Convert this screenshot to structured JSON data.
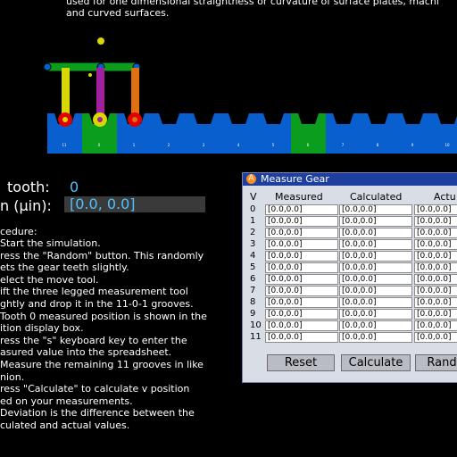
{
  "intro_lines": [
    "used for one dimensional straightness or curvature of surface plates, machi",
    "and curved surfaces."
  ],
  "gear": {
    "teeth": [
      {
        "label": "11",
        "color": "#0a5fcf"
      },
      {
        "label": "0",
        "color": "#0b9e1e"
      },
      {
        "label": "1",
        "color": "#0a5fcf"
      },
      {
        "label": "2",
        "color": "#0a5fcf"
      },
      {
        "label": "3",
        "color": "#0a5fcf"
      },
      {
        "label": "4",
        "color": "#0a5fcf"
      },
      {
        "label": "5",
        "color": "#0a5fcf"
      },
      {
        "label": "6",
        "color": "#0b9e1e"
      },
      {
        "label": "7",
        "color": "#0a5fcf"
      },
      {
        "label": "8",
        "color": "#0a5fcf"
      },
      {
        "label": "9",
        "color": "#0a5fcf"
      },
      {
        "label": "10",
        "color": "#0a5fcf"
      }
    ]
  },
  "tool": {
    "bar_color": "#0b9e1e",
    "leg_colors": [
      "#d8d800",
      "#a020a0",
      "#e07010"
    ],
    "foot_color": "#e00000"
  },
  "readout": {
    "tooth_label": "tooth:",
    "tooth_value": "0",
    "position_label": "n (μin):",
    "position_value": "[0.0, 0.0]"
  },
  "procedure": {
    "title": "cedure:",
    "lines": [
      "Start the simulation.",
      "ress the \"Random\" button. This randomly",
      "ets the gear teeth slightly.",
      "elect the move tool.",
      "ift the three legged measurement tool",
      "ghtly and drop it in the 11-0-1 grooves.",
      "Tooth 0 measured position is shown in the",
      "ition display box.",
      "ress the \"s\" keyboard key to enter the",
      "asured value into the spreadsheet.",
      "Measure the remaining 11 grooves in like",
      "nion.",
      "ress \"Calculate\" to calculate v position",
      "ed on your measurements.",
      "Deviation is the difference between the",
      "culated and actual values."
    ]
  },
  "dialog": {
    "title": "Measure Gear",
    "icon_letter": "A",
    "headers": {
      "v": "V",
      "measured": "Measured",
      "calculated": "Calculated",
      "actual": "Actu"
    },
    "rows": [
      {
        "v": "0",
        "measured": "[0.0,0.0]",
        "calculated": "[0.0,0.0]",
        "actual": "[0.0,0.0]"
      },
      {
        "v": "1",
        "measured": "[0.0,0.0]",
        "calculated": "[0.0,0.0]",
        "actual": "[0.0,0.0]"
      },
      {
        "v": "2",
        "measured": "[0.0,0.0]",
        "calculated": "[0.0,0.0]",
        "actual": "[0.0,0.0]"
      },
      {
        "v": "3",
        "measured": "[0.0,0.0]",
        "calculated": "[0.0,0.0]",
        "actual": "[0.0,0.0]"
      },
      {
        "v": "4",
        "measured": "[0.0,0.0]",
        "calculated": "[0.0,0.0]",
        "actual": "[0.0,0.0]"
      },
      {
        "v": "5",
        "measured": "[0.0,0.0]",
        "calculated": "[0.0,0.0]",
        "actual": "[0.0,0.0]"
      },
      {
        "v": "6",
        "measured": "[0.0,0.0]",
        "calculated": "[0.0,0.0]",
        "actual": "[0.0,0.0]"
      },
      {
        "v": "7",
        "measured": "[0.0,0.0]",
        "calculated": "[0.0,0.0]",
        "actual": "[0.0,0.0]"
      },
      {
        "v": "8",
        "measured": "[0.0,0.0]",
        "calculated": "[0.0,0.0]",
        "actual": "[0.0,0.0]"
      },
      {
        "v": "9",
        "measured": "[0.0,0.0]",
        "calculated": "[0.0,0.0]",
        "actual": "[0.0,0.0]"
      },
      {
        "v": "10",
        "measured": "[0.0,0.0]",
        "calculated": "[0.0,0.0]",
        "actual": "[0.0,0.0]"
      },
      {
        "v": "11",
        "measured": "[0.0,0.0]",
        "calculated": "[0.0,0.0]",
        "actual": "[0.0,0.0]"
      }
    ],
    "buttons": {
      "reset": "Reset",
      "calculate": "Calculate",
      "random": "Rand"
    }
  }
}
